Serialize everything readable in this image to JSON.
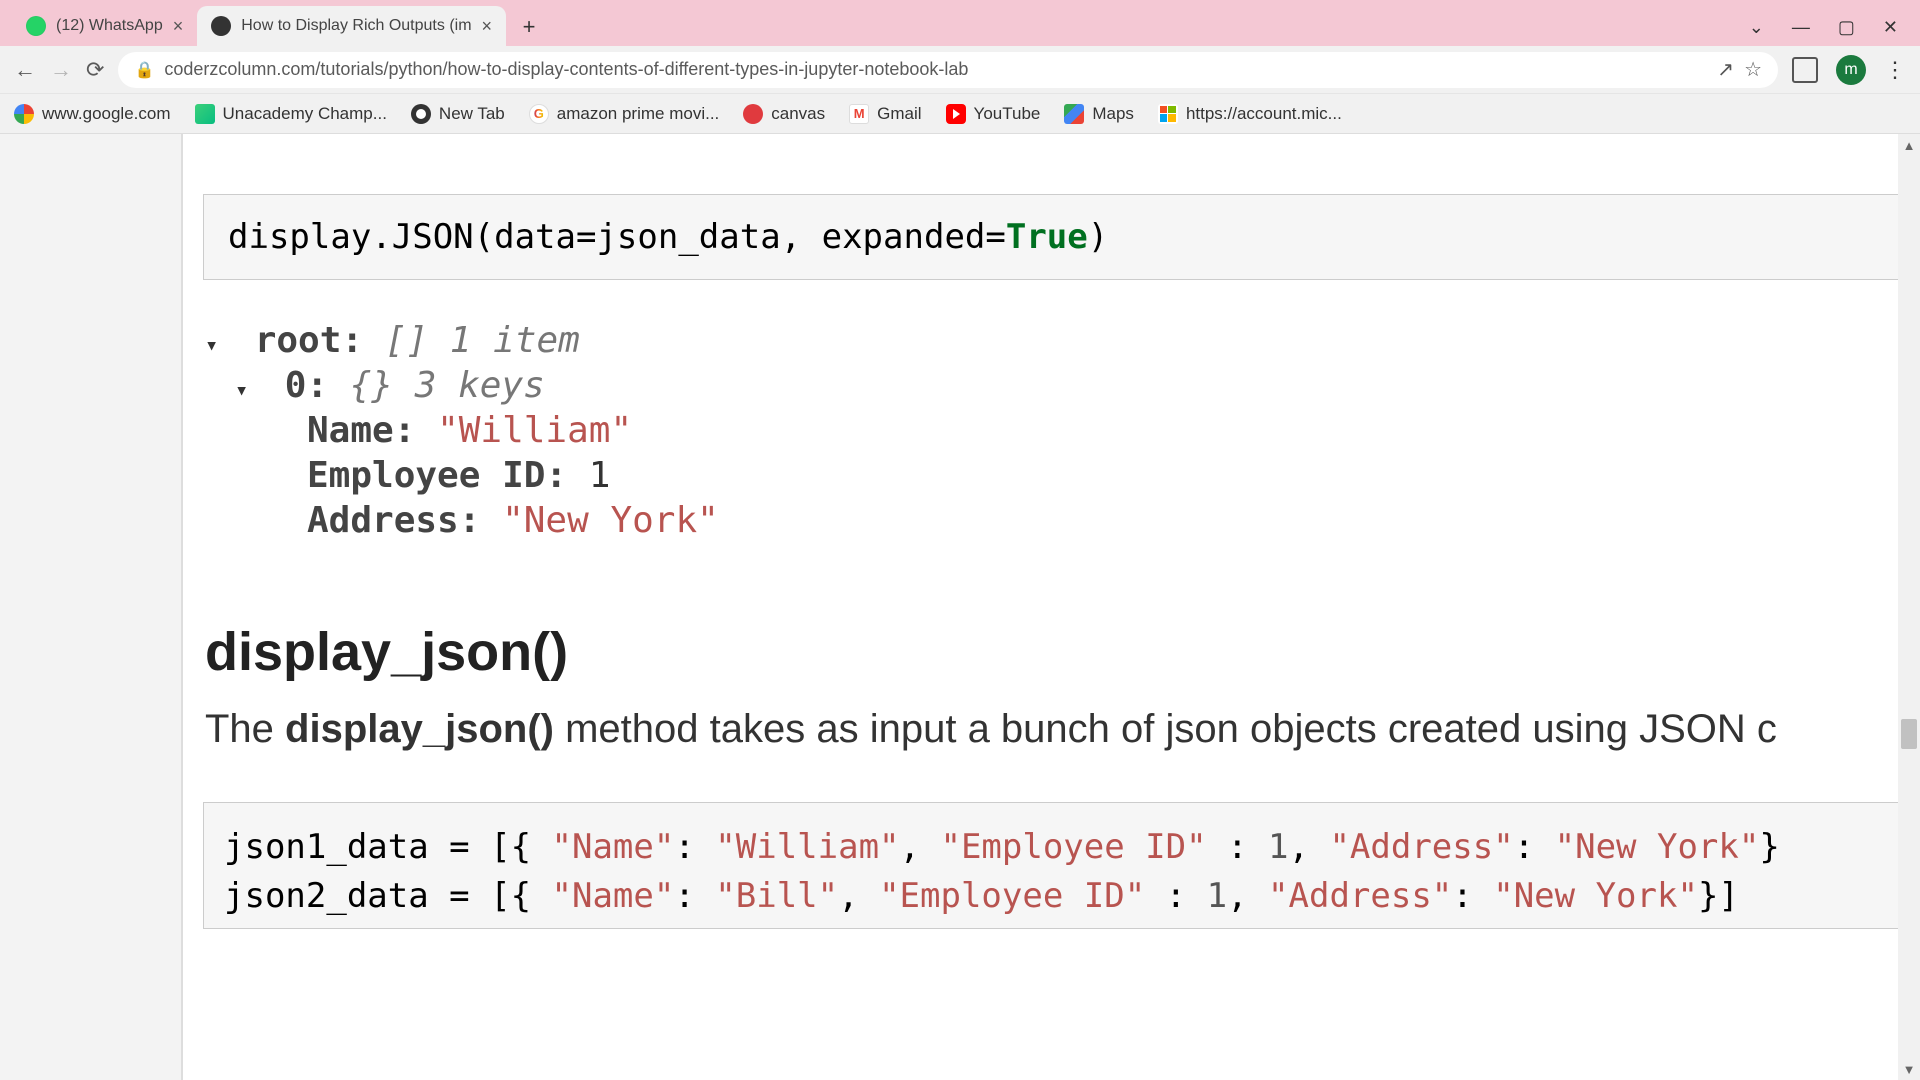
{
  "tabs": [
    {
      "title": "(12) WhatsApp",
      "active": false
    },
    {
      "title": "How to Display Rich Outputs (im",
      "active": true
    }
  ],
  "url": "coderzcolumn.com/tutorials/python/how-to-display-contents-of-different-types-in-jupyter-notebook-lab",
  "avatar_letter": "m",
  "bookmarks": [
    {
      "label": "www.google.com",
      "icon": "google"
    },
    {
      "label": "Unacademy Champ...",
      "icon": "unacademy"
    },
    {
      "label": "New Tab",
      "icon": "newtab"
    },
    {
      "label": "amazon prime movi...",
      "icon": "google2"
    },
    {
      "label": "canvas",
      "icon": "canvas"
    },
    {
      "label": "Gmail",
      "icon": "gmail"
    },
    {
      "label": "YouTube",
      "icon": "youtube"
    },
    {
      "label": "Maps",
      "icon": "maps"
    },
    {
      "label": "https://account.mic...",
      "icon": "ms"
    }
  ],
  "code1": {
    "prefix": "display.JSON(data=json_data, expanded=",
    "kw": "True",
    "suffix": ")"
  },
  "tree": {
    "root_label": "root:",
    "root_meta": "[] 1 item",
    "idx0_label": "0:",
    "idx0_meta": "{} 3 keys",
    "name_k": "Name:",
    "name_v": "\"William\"",
    "emp_k": "Employee ID:",
    "emp_v": "1",
    "addr_k": "Address:",
    "addr_v": "\"New York\""
  },
  "heading": "display_json()",
  "paragraph": {
    "pre": "The ",
    "bold": "display_json()",
    "post": " method takes as input a bunch of json objects created using JSON c"
  },
  "code2": {
    "l1_var": "json1_data = [{ ",
    "l1_k1": "\"Name\"",
    "l1_c1": ": ",
    "l1_v1": "\"William\"",
    "l1_c2": ", ",
    "l1_k2": "\"Employee ID\"",
    "l1_c3": " : ",
    "l1_v2": "1",
    "l1_c4": ", ",
    "l1_k3": "\"Address\"",
    "l1_c5": ": ",
    "l1_v3": "\"New York\"",
    "l1_end": "}",
    "l2_var": "json2_data = [{ ",
    "l2_k1": "\"Name\"",
    "l2_c1": ": ",
    "l2_v1": "\"Bill\"",
    "l2_c2": ", ",
    "l2_k2": "\"Employee ID\"",
    "l2_c3": " : ",
    "l2_v2": "1",
    "l2_c4": ", ",
    "l2_k3": "\"Address\"",
    "l2_c5": ": ",
    "l2_v3": "\"New York\"",
    "l2_end": "}]"
  }
}
